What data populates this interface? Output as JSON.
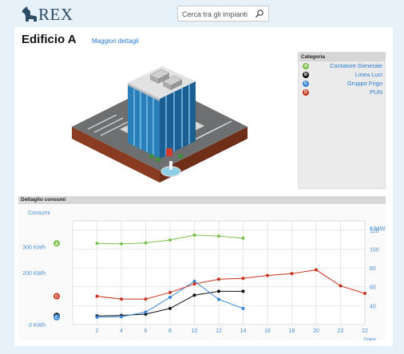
{
  "app": {
    "logo_text": "REX",
    "search_placeholder": "Cerca tra gli impianti"
  },
  "page": {
    "title": "Edificio A",
    "more_details": "Maggiori dettagli"
  },
  "categories": {
    "header": "Categoria",
    "items": [
      {
        "badge": "A",
        "label": "Contatore Generale",
        "color": "#7cc24a"
      },
      {
        "badge": "B",
        "label": "Linea Luci",
        "color": "#111111"
      },
      {
        "badge": "C",
        "label": "Gruppo Frigo",
        "color": "#3a84d8"
      },
      {
        "badge": "D",
        "label": "PUN",
        "color": "#c8321f"
      }
    ]
  },
  "details": {
    "header": "Dettaglio consumi"
  },
  "chart_data": {
    "type": "line",
    "ylabel": "Consumi",
    "y2label": "€/MWh",
    "xlabel": "Orario",
    "x_ticks": [
      2,
      4,
      6,
      8,
      10,
      12,
      14,
      16,
      18,
      20,
      22,
      22
    ],
    "y_ticks": [
      "0 KWh",
      "200 KWh",
      "300 KWh"
    ],
    "y2_ticks": [
      40,
      60,
      80,
      100,
      120
    ],
    "series": [
      {
        "badge": "A",
        "color": "#7cc24a",
        "x": [
          2,
          4,
          6,
          8,
          10,
          12,
          14
        ],
        "y": [
          313,
          311,
          315,
          326,
          345,
          341,
          333
        ]
      },
      {
        "badge": "B",
        "color": "#111111",
        "x": [
          2,
          4,
          6,
          8,
          10,
          12,
          14
        ],
        "y": [
          33,
          35,
          40,
          62,
          113,
          128,
          128
        ]
      },
      {
        "badge": "C",
        "color": "#3a84d8",
        "x": [
          2,
          4,
          6,
          8,
          10,
          12,
          14
        ],
        "y": [
          28,
          30,
          48,
          105,
          167,
          97,
          62
        ]
      },
      {
        "badge": "D",
        "axis": "right",
        "color": "#c8321f",
        "x": [
          2,
          4,
          6,
          8,
          10,
          12,
          14,
          16,
          18,
          20,
          22,
          24
        ],
        "y": [
          50,
          47,
          47,
          54,
          63,
          68,
          69,
          72,
          74,
          78,
          61,
          53
        ]
      }
    ]
  }
}
